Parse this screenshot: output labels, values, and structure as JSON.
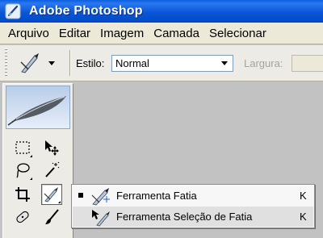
{
  "window": {
    "title": "Adobe Photoshop"
  },
  "menu": {
    "items": [
      {
        "label": "Arquivo"
      },
      {
        "label": "Editar"
      },
      {
        "label": "Imagem"
      },
      {
        "label": "Camada"
      },
      {
        "label": "Selecionar"
      }
    ]
  },
  "options": {
    "preset_icon": "slice-tool-icon",
    "style_label": "Estilo:",
    "style_value": "Normal",
    "width_label": "Largura:",
    "width_value": ""
  },
  "toolbox": {
    "header_icon": "feather-icon",
    "tools": [
      {
        "icon": "rectangular-marquee-icon",
        "active": false
      },
      {
        "icon": "move-icon",
        "active": false
      },
      {
        "icon": "lasso-icon",
        "active": false
      },
      {
        "icon": "magic-wand-icon",
        "active": false
      },
      {
        "icon": "crop-icon",
        "active": false
      },
      {
        "icon": "slice-tool-icon",
        "active": true
      },
      {
        "icon": "healing-brush-icon",
        "active": false
      },
      {
        "icon": "brush-icon",
        "active": false
      }
    ]
  },
  "flyout": {
    "items": [
      {
        "label": "Ferramenta Fatia",
        "shortcut": "K",
        "icon": "slice-tool-icon",
        "checked": true
      },
      {
        "label": "Ferramenta Seleção de Fatia",
        "shortcut": "K",
        "icon": "slice-select-tool-icon",
        "checked": false
      }
    ]
  },
  "colors": {
    "titlebar": "#0a56d8",
    "menubar": "#ece9d8",
    "workspace": "#c2c2c2",
    "selected_flyout_row": "#e0e0e0"
  }
}
